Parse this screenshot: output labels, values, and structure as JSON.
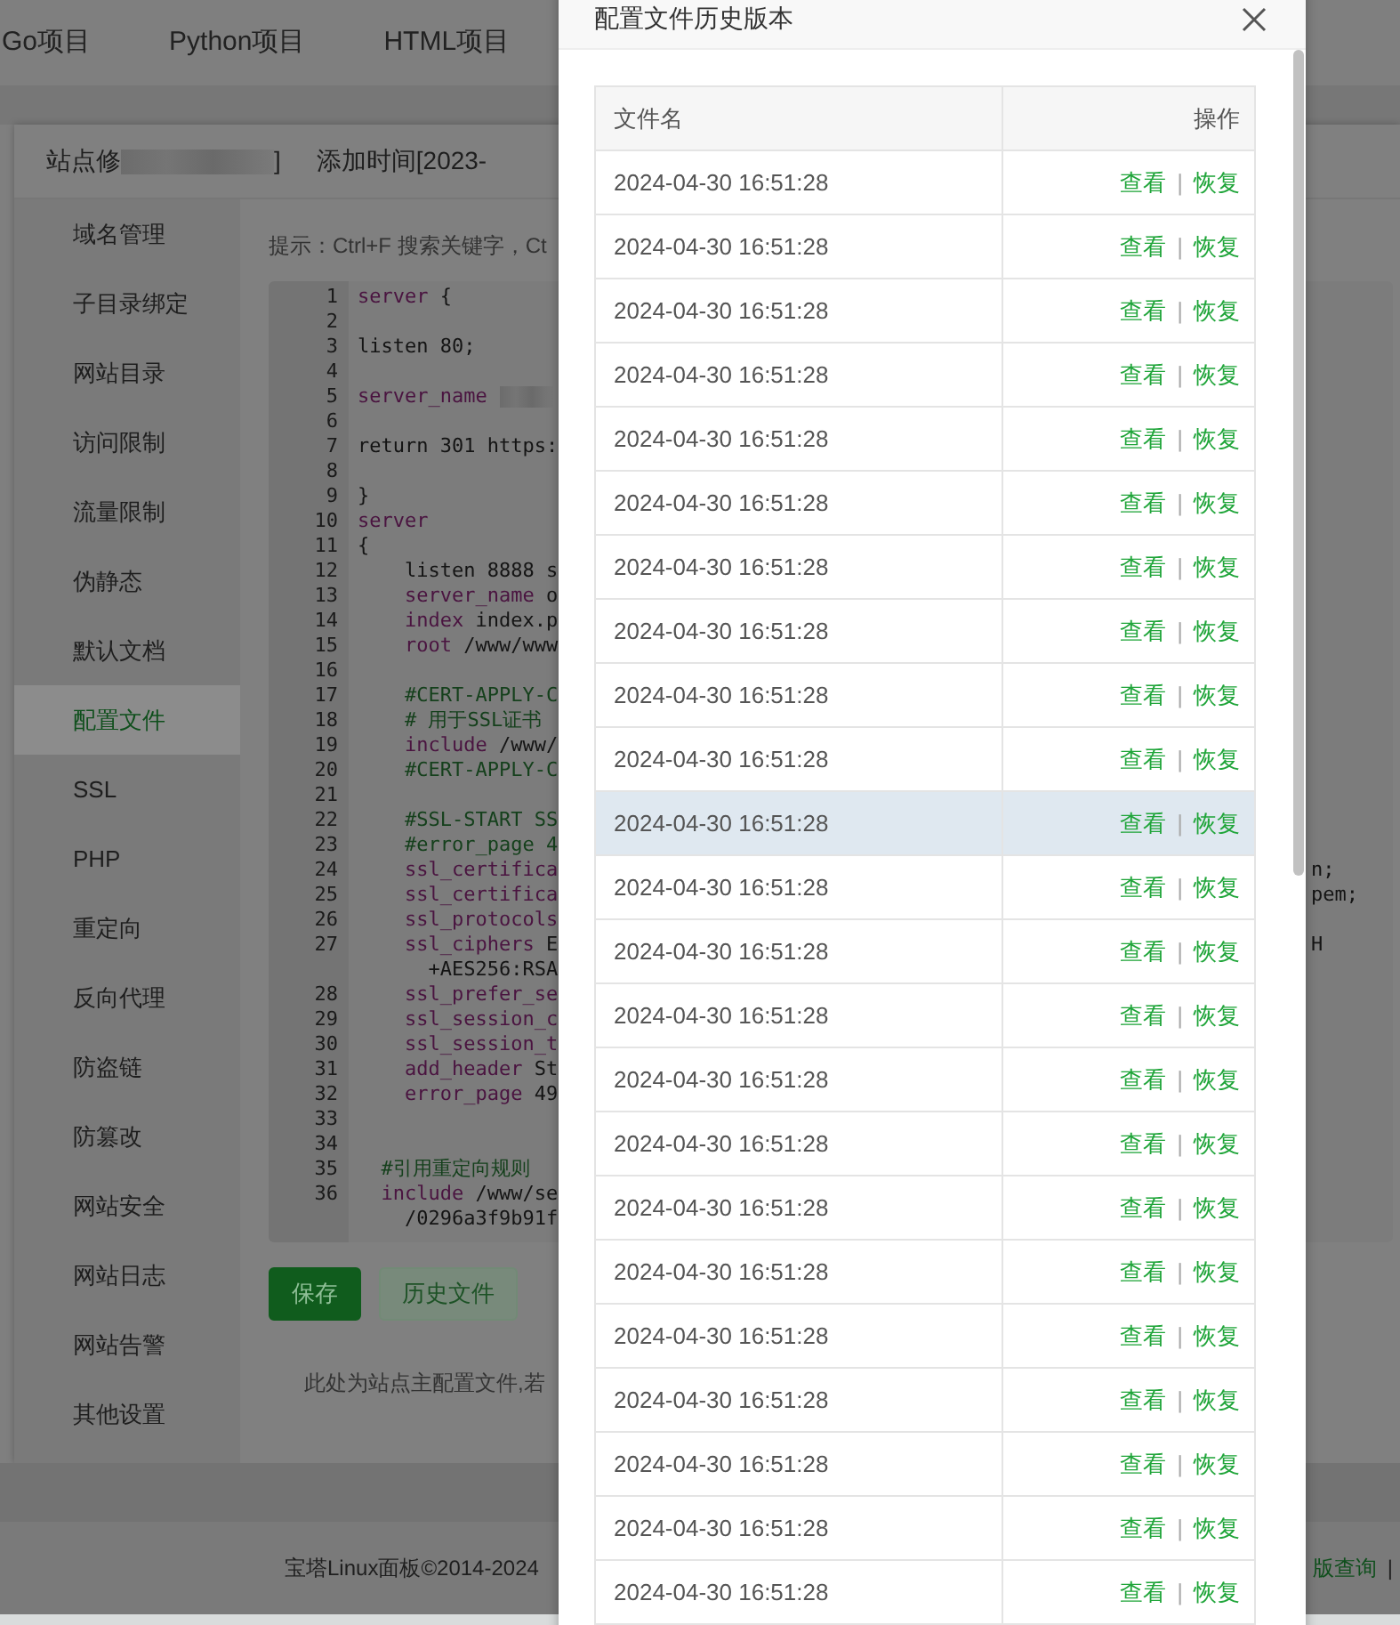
{
  "top_nav": {
    "items": [
      "Go项目",
      "Python项目",
      "HTML项目"
    ]
  },
  "site_dialog": {
    "title_start": "站点修",
    "title_end": "]",
    "added_time": "添加时间[2023-"
  },
  "menu": [
    {
      "label": "域名管理",
      "selected": false
    },
    {
      "label": "子目录绑定",
      "selected": false
    },
    {
      "label": "网站目录",
      "selected": false
    },
    {
      "label": "访问限制",
      "selected": false
    },
    {
      "label": "流量限制",
      "selected": false
    },
    {
      "label": "伪静态",
      "selected": false
    },
    {
      "label": "默认文档",
      "selected": false
    },
    {
      "label": "配置文件",
      "selected": true
    },
    {
      "label": "SSL",
      "selected": false
    },
    {
      "label": "PHP",
      "selected": false
    },
    {
      "label": "重定向",
      "selected": false
    },
    {
      "label": "反向代理",
      "selected": false
    },
    {
      "label": "防盗链",
      "selected": false
    },
    {
      "label": "防篡改",
      "selected": false
    },
    {
      "label": "网站安全",
      "selected": false
    },
    {
      "label": "网站日志",
      "selected": false
    },
    {
      "label": "网站告警",
      "selected": false
    },
    {
      "label": "其他设置",
      "selected": false
    }
  ],
  "tip": "提示：Ctrl+F 搜索关键字，Ct",
  "editor": {
    "lines": [
      {
        "number": "1",
        "kind": "directive",
        "text": "server {"
      },
      {
        "number": "2",
        "kind": "blank"
      },
      {
        "number": "3",
        "kind": "plain",
        "text": "listen 80;"
      },
      {
        "number": "4",
        "kind": "blank"
      },
      {
        "number": "5",
        "kind": "directive",
        "text": "server_name",
        "redacted": true
      },
      {
        "number": "6",
        "kind": "blank"
      },
      {
        "number": "7",
        "kind": "plain",
        "text": "return 301 https:"
      },
      {
        "number": "8",
        "kind": "blank"
      },
      {
        "number": "9",
        "kind": "plain",
        "text": "}"
      },
      {
        "number": "10",
        "kind": "directive",
        "text": "server"
      },
      {
        "number": "11",
        "kind": "plain",
        "text": "{"
      },
      {
        "number": "12",
        "kind": "plain",
        "text": "    listen 8888 s"
      },
      {
        "number": "13",
        "kind": "directive",
        "text": "    server_name o"
      },
      {
        "number": "14",
        "kind": "directive",
        "text": "    index index.p"
      },
      {
        "number": "15",
        "kind": "directive",
        "text": "    root /www/www"
      },
      {
        "number": "16",
        "kind": "blank"
      },
      {
        "number": "17",
        "kind": "comment",
        "text": "    #CERT-APPLY-C"
      },
      {
        "number": "18",
        "kind": "comment",
        "text": "    # 用于SSL证书"
      },
      {
        "number": "19",
        "kind": "directive",
        "text": "    include /www/"
      },
      {
        "number": "20",
        "kind": "comment",
        "text": "    #CERT-APPLY-C"
      },
      {
        "number": "21",
        "kind": "blank"
      },
      {
        "number": "22",
        "kind": "comment",
        "text": "    #SSL-START SS"
      },
      {
        "number": "23",
        "kind": "comment",
        "text": "    #error_page 4"
      },
      {
        "number": "24",
        "kind": "directive",
        "text": "    ssl_certifica",
        "tail": "n;"
      },
      {
        "number": "25",
        "kind": "directive",
        "text": "    ssl_certifica",
        "tail": "pem;"
      },
      {
        "number": "26",
        "kind": "directive",
        "text": "    ssl_protocols"
      },
      {
        "number": "27",
        "kind": "directive",
        "text": "    ssl_ciphers E",
        "tail": "H"
      },
      {
        "kind": "wrap",
        "text": "      +AES256:RSA"
      },
      {
        "number": "28",
        "kind": "directive",
        "text": "    ssl_prefer_se"
      },
      {
        "number": "29",
        "kind": "directive",
        "text": "    ssl_session_c"
      },
      {
        "number": "30",
        "kind": "directive",
        "text": "    ssl_session_t"
      },
      {
        "number": "31",
        "kind": "directive",
        "text": "    add_header St"
      },
      {
        "number": "32",
        "kind": "directive",
        "text": "    error_page 49"
      },
      {
        "number": "33",
        "kind": "blank"
      },
      {
        "number": "34",
        "kind": "blank"
      },
      {
        "number": "35",
        "kind": "comment",
        "text": "  #引用重定向规则"
      },
      {
        "number": "36",
        "kind": "directive",
        "text": "  include /www/se"
      },
      {
        "kind": "wrap",
        "text": "    /0296a3f9b91f"
      }
    ]
  },
  "buttons": [
    {
      "label": "保存",
      "kind": "primary"
    },
    {
      "label": "历史文件",
      "kind": "secondary"
    }
  ],
  "note": "此处为站点主配置文件,若",
  "footer": {
    "copyright": "宝塔Linux面板©2014-2024",
    "link": "版查询",
    "separator": "|"
  },
  "modal": {
    "title": "配置文件历史版本",
    "columns": [
      "文件名",
      "操作"
    ],
    "rows": [
      {
        "file": "2024-04-30 16:51:28",
        "view": "查看",
        "sep": "|",
        "restore": "恢复",
        "highlighted": false
      },
      {
        "file": "2024-04-30 16:51:28",
        "view": "查看",
        "sep": "|",
        "restore": "恢复",
        "highlighted": false
      },
      {
        "file": "2024-04-30 16:51:28",
        "view": "查看",
        "sep": "|",
        "restore": "恢复",
        "highlighted": false
      },
      {
        "file": "2024-04-30 16:51:28",
        "view": "查看",
        "sep": "|",
        "restore": "恢复",
        "highlighted": false
      },
      {
        "file": "2024-04-30 16:51:28",
        "view": "查看",
        "sep": "|",
        "restore": "恢复",
        "highlighted": false
      },
      {
        "file": "2024-04-30 16:51:28",
        "view": "查看",
        "sep": "|",
        "restore": "恢复",
        "highlighted": false
      },
      {
        "file": "2024-04-30 16:51:28",
        "view": "查看",
        "sep": "|",
        "restore": "恢复",
        "highlighted": false
      },
      {
        "file": "2024-04-30 16:51:28",
        "view": "查看",
        "sep": "|",
        "restore": "恢复",
        "highlighted": false
      },
      {
        "file": "2024-04-30 16:51:28",
        "view": "查看",
        "sep": "|",
        "restore": "恢复",
        "highlighted": false
      },
      {
        "file": "2024-04-30 16:51:28",
        "view": "查看",
        "sep": "|",
        "restore": "恢复",
        "highlighted": false
      },
      {
        "file": "2024-04-30 16:51:28",
        "view": "查看",
        "sep": "|",
        "restore": "恢复",
        "highlighted": true
      },
      {
        "file": "2024-04-30 16:51:28",
        "view": "查看",
        "sep": "|",
        "restore": "恢复",
        "highlighted": false
      },
      {
        "file": "2024-04-30 16:51:28",
        "view": "查看",
        "sep": "|",
        "restore": "恢复",
        "highlighted": false
      },
      {
        "file": "2024-04-30 16:51:28",
        "view": "查看",
        "sep": "|",
        "restore": "恢复",
        "highlighted": false
      },
      {
        "file": "2024-04-30 16:51:28",
        "view": "查看",
        "sep": "|",
        "restore": "恢复",
        "highlighted": false
      },
      {
        "file": "2024-04-30 16:51:28",
        "view": "查看",
        "sep": "|",
        "restore": "恢复",
        "highlighted": false
      },
      {
        "file": "2024-04-30 16:51:28",
        "view": "查看",
        "sep": "|",
        "restore": "恢复",
        "highlighted": false
      },
      {
        "file": "2024-04-30 16:51:28",
        "view": "查看",
        "sep": "|",
        "restore": "恢复",
        "highlighted": false
      },
      {
        "file": "2024-04-30 16:51:28",
        "view": "查看",
        "sep": "|",
        "restore": "恢复",
        "highlighted": false
      },
      {
        "file": "2024-04-30 16:51:28",
        "view": "查看",
        "sep": "|",
        "restore": "恢复",
        "highlighted": false
      },
      {
        "file": "2024-04-30 16:51:28",
        "view": "查看",
        "sep": "|",
        "restore": "恢复",
        "highlighted": false
      },
      {
        "file": "2024-04-30 16:51:28",
        "view": "查看",
        "sep": "|",
        "restore": "恢复",
        "highlighted": false
      },
      {
        "file": "2024-04-30 16:51:28",
        "view": "查看",
        "sep": "|",
        "restore": "恢复",
        "highlighted": false
      }
    ]
  }
}
